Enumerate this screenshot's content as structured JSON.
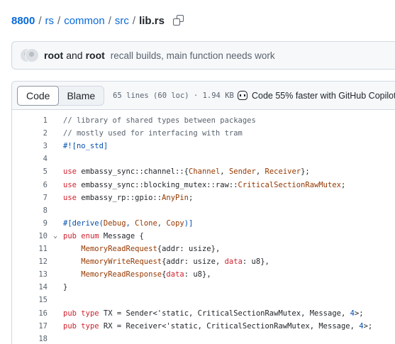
{
  "breadcrumb": {
    "root": "8800",
    "parts": [
      "rs",
      "common",
      "src"
    ],
    "file": "lib.rs",
    "separator": "/"
  },
  "commit": {
    "author1": "root",
    "joiner": "and",
    "author2": "root",
    "message": "recall builds, main function needs work"
  },
  "file_header": {
    "tab_code": "Code",
    "tab_blame": "Blame",
    "info": "65 lines (60 loc) · 1.94 KB",
    "copilot": "Code 55% faster with GitHub Copilot"
  },
  "colors": {
    "link": "#0969da",
    "keyword": "#cf222e",
    "type": "#953800",
    "comment": "#59636e",
    "number": "#0550ae"
  },
  "code_lines": [
    {
      "n": "1",
      "tokens": [
        [
          "cm",
          "// library of shared types between packages"
        ]
      ]
    },
    {
      "n": "2",
      "tokens": [
        [
          "cm",
          "// mostly used for interfacing with tram"
        ]
      ]
    },
    {
      "n": "3",
      "tokens": [
        [
          "mac",
          "#![no_std]"
        ]
      ]
    },
    {
      "n": "4",
      "tokens": []
    },
    {
      "n": "5",
      "tokens": [
        [
          "kw",
          "use"
        ],
        [
          "pl",
          " embassy_sync::channel::{"
        ],
        [
          "ty",
          "Channel"
        ],
        [
          "pl",
          ", "
        ],
        [
          "ty",
          "Sender"
        ],
        [
          "pl",
          ", "
        ],
        [
          "ty",
          "Receiver"
        ],
        [
          "pl",
          "};"
        ]
      ]
    },
    {
      "n": "6",
      "tokens": [
        [
          "kw",
          "use"
        ],
        [
          "pl",
          " embassy_sync::blocking_mutex::raw::"
        ],
        [
          "ty",
          "CriticalSectionRawMutex"
        ],
        [
          "pl",
          ";"
        ]
      ]
    },
    {
      "n": "7",
      "tokens": [
        [
          "kw",
          "use"
        ],
        [
          "pl",
          " embassy_rp::gpio::"
        ],
        [
          "ty",
          "AnyPin"
        ],
        [
          "pl",
          ";"
        ]
      ]
    },
    {
      "n": "8",
      "tokens": []
    },
    {
      "n": "9",
      "tokens": [
        [
          "mac",
          "#[derive("
        ],
        [
          "ty",
          "Debug"
        ],
        [
          "mac",
          ", "
        ],
        [
          "ty",
          "Clone"
        ],
        [
          "mac",
          ", "
        ],
        [
          "ty",
          "Copy"
        ],
        [
          "mac",
          ")]"
        ]
      ]
    },
    {
      "n": "10",
      "fold": "⌄",
      "tokens": [
        [
          "kw",
          "pub"
        ],
        [
          "pl",
          " "
        ],
        [
          "kw",
          "enum"
        ],
        [
          "pl",
          " Message {"
        ]
      ]
    },
    {
      "n": "11",
      "tokens": [
        [
          "pl",
          "    "
        ],
        [
          "ty",
          "MemoryReadRequest"
        ],
        [
          "pl",
          "{addr: usize},"
        ]
      ]
    },
    {
      "n": "12",
      "tokens": [
        [
          "pl",
          "    "
        ],
        [
          "ty",
          "MemoryWriteRequest"
        ],
        [
          "pl",
          "{addr: usize, "
        ],
        [
          "kw",
          "data"
        ],
        [
          "pl",
          ": u8},"
        ]
      ]
    },
    {
      "n": "13",
      "tokens": [
        [
          "pl",
          "    "
        ],
        [
          "ty",
          "MemoryReadResponse"
        ],
        [
          "pl",
          "{"
        ],
        [
          "kw",
          "data"
        ],
        [
          "pl",
          ": u8},"
        ]
      ]
    },
    {
      "n": "14",
      "tokens": [
        [
          "pl",
          "}"
        ]
      ]
    },
    {
      "n": "15",
      "tokens": []
    },
    {
      "n": "16",
      "tokens": [
        [
          "kw",
          "pub"
        ],
        [
          "pl",
          " "
        ],
        [
          "kw",
          "type"
        ],
        [
          "pl",
          " TX = Sender<'static, CriticalSectionRawMutex, Message, "
        ],
        [
          "nm",
          "4"
        ],
        [
          "pl",
          ">;"
        ]
      ]
    },
    {
      "n": "17",
      "tokens": [
        [
          "kw",
          "pub"
        ],
        [
          "pl",
          " "
        ],
        [
          "kw",
          "type"
        ],
        [
          "pl",
          " RX = Receiver<'static, CriticalSectionRawMutex, Message, "
        ],
        [
          "nm",
          "4"
        ],
        [
          "pl",
          ">;"
        ]
      ]
    },
    {
      "n": "18",
      "tokens": []
    }
  ]
}
